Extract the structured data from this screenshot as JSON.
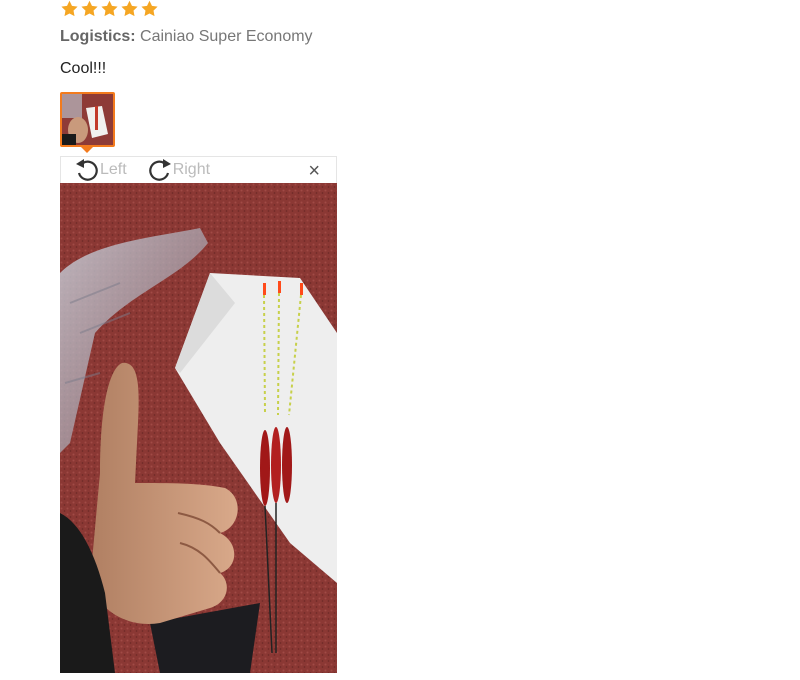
{
  "review": {
    "rating": 5,
    "rating_max": 5,
    "star_color": "#f5a623",
    "logistics_label": "Logistics:",
    "logistics_value": "Cainiao Super Economy",
    "comment": "Cool!!!"
  },
  "viewer": {
    "rotate_left_label": "Left",
    "rotate_right_label": "Right",
    "close_glyph": "×",
    "accent": "#f37b1d",
    "rotate_left_icon": "rotate-left-icon",
    "rotate_right_icon": "rotate-right-icon",
    "close_icon": "close-icon"
  }
}
